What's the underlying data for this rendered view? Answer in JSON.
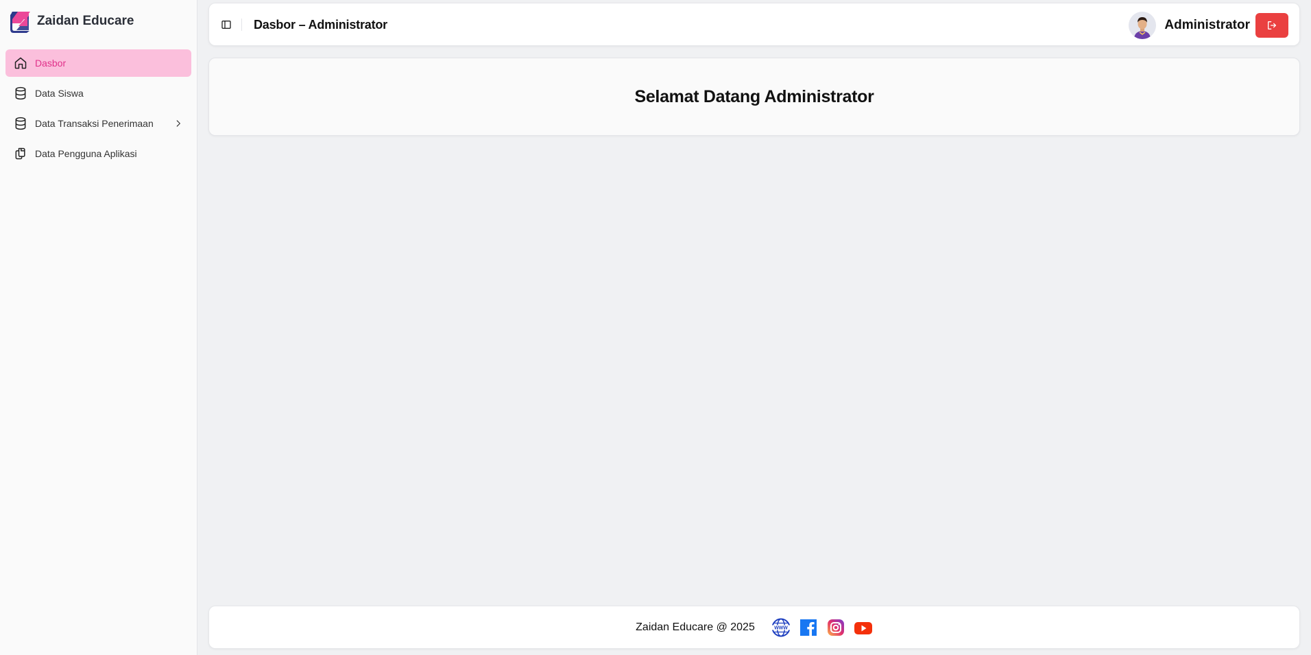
{
  "brand": {
    "name": "Zaidan Educare",
    "colors": {
      "pink": "#ec4899",
      "navy": "#2e3a8c"
    }
  },
  "sidebar": {
    "items": [
      {
        "label": "Dasbor",
        "icon": "home-icon",
        "active": true
      },
      {
        "label": "Data Siswa",
        "icon": "database-icon",
        "active": false
      },
      {
        "label": "Data Transaksi Penerimaan",
        "icon": "database-icon",
        "active": false,
        "expandable": true
      },
      {
        "label": "Data Pengguna Aplikasi",
        "icon": "copy-document-icon",
        "active": false
      }
    ],
    "active_color": "#e0318a",
    "active_bg": "#fbbfdc"
  },
  "header": {
    "title": "Dasbor – Administrator",
    "toggle_icon": "sidebar-toggle-icon",
    "user": {
      "name": "Administrator",
      "avatar": "user-avatar"
    },
    "logout_icon": "logout-icon",
    "logout_color": "#ea4040"
  },
  "main": {
    "welcome": "Selamat Datang Administrator"
  },
  "footer": {
    "text": "Zaidan Educare @ 2025",
    "social": [
      {
        "name": "website",
        "icon": "www-globe-icon"
      },
      {
        "name": "facebook",
        "icon": "facebook-icon"
      },
      {
        "name": "instagram",
        "icon": "instagram-icon"
      },
      {
        "name": "youtube",
        "icon": "youtube-icon"
      }
    ]
  }
}
